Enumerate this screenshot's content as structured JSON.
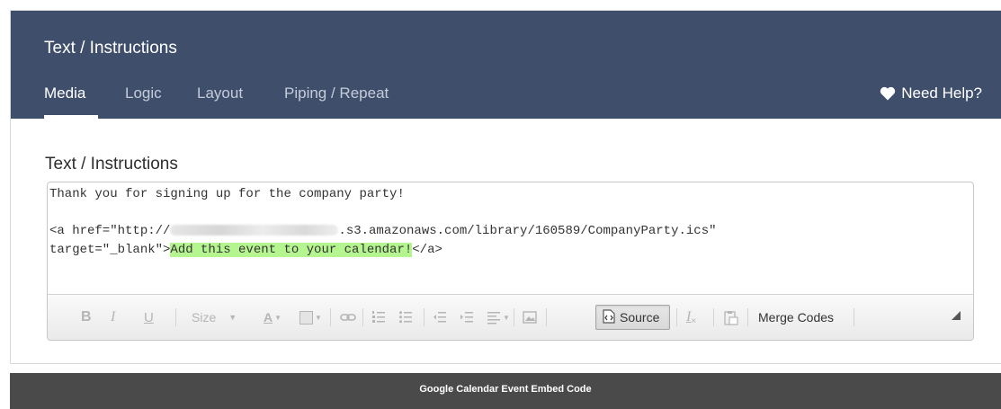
{
  "header": {
    "title": "Text / Instructions",
    "tabs": [
      {
        "label": "Media",
        "active": true
      },
      {
        "label": "Logic",
        "active": false
      },
      {
        "label": "Layout",
        "active": false
      },
      {
        "label": "Piping / Repeat",
        "active": false
      }
    ],
    "help_label": "Need Help?",
    "help_icon": "heart-icon"
  },
  "editor": {
    "label": "Text / Instructions",
    "line1": "Thank you for signing up for the company party!",
    "line3_prefix": "<a href=\"http://",
    "line3_suffix": ".s3.amazonaws.com/library/160589/CompanyParty.ics\"",
    "line4_prefix": "target=\"_blank\">",
    "line4_highlight": "Add this event to your calendar!",
    "line4_suffix": "</a>",
    "highlight_color": "#b5f58f"
  },
  "toolbar": {
    "bold": "B",
    "italic": "I",
    "underline": "U",
    "size_label": "Size",
    "text_color_label": "A",
    "source_label": "Source",
    "remove_format_label": "I",
    "merge_codes_label": "Merge Codes"
  },
  "footer": {
    "title": "Google Calendar Event Embed Code"
  },
  "colors": {
    "header_bg": "#3f4e6b",
    "footer_bg": "#4a4a4a"
  }
}
